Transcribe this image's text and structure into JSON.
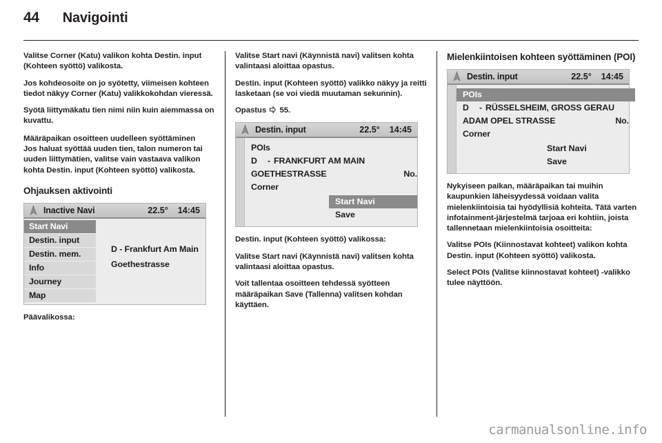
{
  "header": {
    "page_number": "44",
    "title": "Navigointi"
  },
  "watermark": "carmanualsonline.info",
  "columns": {
    "left": {
      "para1": "Valitse Corner (Katu) valikon kohta Destin. input (Kohteen syöttö) valikosta.",
      "para2": "Jos kohdeosoite on jo syötetty, viimeisen kohteen tiedot näkyy Corner (Katu) valikkokohdan vieressä.",
      "para3": "Syötä liittymäkatu tien nimi niin kuin aiemmassa on kuvattu.",
      "sub1": "Määräpaikan osoitteen uudelleen syöttäminen",
      "para4": "Jos haluat syöttää uuden tien, talon numeron tai uuden liittymätien, valitse vain vastaava valikon kohta Destin. input (Kohteen syöttö) valikosta.",
      "section1": "Ohjauksen aktivointi",
      "after_screen": "Päävalikossa:",
      "screen": {
        "bar_title": "Inactive Navi",
        "temperature": "22.5°",
        "time": "14:45",
        "menu": [
          {
            "label": "Start Navi",
            "highlighted": true
          },
          {
            "label": "Destin. input",
            "highlighted": false
          },
          {
            "label": "Destin. mem.",
            "highlighted": false
          },
          {
            "label": "Info",
            "highlighted": false
          },
          {
            "label": "Journey",
            "highlighted": false
          },
          {
            "label": "Map",
            "highlighted": false
          }
        ],
        "side_lines": [
          "D - Frankfurt Am Main",
          "Goethestrasse"
        ]
      }
    },
    "middle": {
      "para1": "Valitse Start navi (Käynnistä navi) valitsen kohta valintaasi aloittaa opastus.",
      "para2": "Destin. input (Kohteen syöttö) valikko näkyy ja reitti lasketaan (se voi viedä muutaman sekunnin).",
      "para3": "Opastus",
      "para3_ref": "55.",
      "para4": "Destin. input (Kohteen syöttö) valikossa:",
      "para5": "Valitse Start navi (Käynnistä navi) valitsen kohta valintaasi aloittaa opastus.",
      "para6": "Voit tallentaa osoitteen tehdessä syötteen määräpaikan Save (Tallenna) valitsen kohdan käyttäen.",
      "screen": {
        "bar_title": "Destin. input",
        "temperature": "22.5°",
        "time": "14:45",
        "rows": [
          {
            "label": "POIs",
            "country": "",
            "right": "",
            "highlighted": false
          },
          {
            "label": "FRANKFURT AM MAIN",
            "country": "D",
            "dash": "-",
            "right": "",
            "highlighted": false
          },
          {
            "label": "GOETHESTRASSE",
            "country": "",
            "right": "No.",
            "highlighted": false
          },
          {
            "label": "Corner",
            "country": "",
            "right": "",
            "highlighted": false
          }
        ],
        "buttons": [
          {
            "label": "Start Navi",
            "highlighted": true
          },
          {
            "label": "Save",
            "highlighted": false
          }
        ]
      }
    },
    "right": {
      "section1": "Mielenkiintoisen kohteen syöttäminen (POI)",
      "para1": "Nykyiseen paikan, määräpaikan tai muihin kaupunkien läheisyydessä voidaan valita mielenkiintoisia tai hyödyllisiä kohteita. Tätä varten infotainment-järjestelmä tarjoaa eri kohtiin, joista tallennetaan mielenkiintoisia osoitteita:",
      "para2": "Valitse POIs (Kiinnostavat kohteet) valikon kohta Destin. input (Kohteen syöttö) valikosta.",
      "para3": "Select POIs (Valitse kiinnostavat kohteet) -valikko tulee näyttöön.",
      "screen": {
        "bar_title": "Destin. input",
        "temperature": "22.5°",
        "time": "14:45",
        "rows": [
          {
            "label": "POIs",
            "country": "",
            "right": "",
            "highlighted": true
          },
          {
            "label": "RÜSSELSHEIM, GROSS GERAU",
            "country": "D",
            "dash": "-",
            "right": "",
            "highlighted": false
          },
          {
            "label": "ADAM OPEL STRASSE",
            "country": "",
            "right": "No.",
            "highlighted": false
          },
          {
            "label": "Corner",
            "country": "",
            "right": "",
            "highlighted": false
          }
        ],
        "buttons": [
          {
            "label": "Start Navi",
            "highlighted": false
          },
          {
            "label": "Save",
            "highlighted": false
          }
        ]
      }
    }
  },
  "icons": {
    "nav_arrow": "navigation-arrow-icon",
    "cross_ref": "cross-reference-icon"
  }
}
